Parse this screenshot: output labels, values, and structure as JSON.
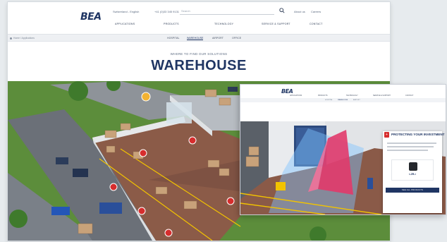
{
  "main": {
    "logo": "BEA",
    "header": {
      "language": "Switzerland - English",
      "phone": "+41 (0)33 345 9131",
      "search_placeholder": "Search",
      "links": [
        "About us",
        "Careers"
      ]
    },
    "nav": [
      "Applications",
      "Products",
      "Technology",
      "Service & Support",
      "Contact"
    ],
    "breadcrumb": "Home / Applications",
    "subtabs": [
      "Hospital",
      "Warehouse",
      "Airport",
      "Office"
    ],
    "active_subtab": "Warehouse",
    "kicker": "Where to find our solutions",
    "title": "WAREHOUSE",
    "hotspot_icon": "plus-icon"
  },
  "overlay": {
    "logo": "BEA",
    "nav": [
      "Applications",
      "Products",
      "Technology",
      "Service & Support",
      "Contact"
    ],
    "panel": {
      "title": "PROTECTING YOUR INVESTMENT",
      "product_code": "LZR-i",
      "button_label": "See all products"
    }
  },
  "colors": {
    "brand_navy": "#1f3563",
    "hotspot_red": "#d62d2d",
    "grass": "#5a8a3a",
    "floor": "#8a5a48"
  }
}
